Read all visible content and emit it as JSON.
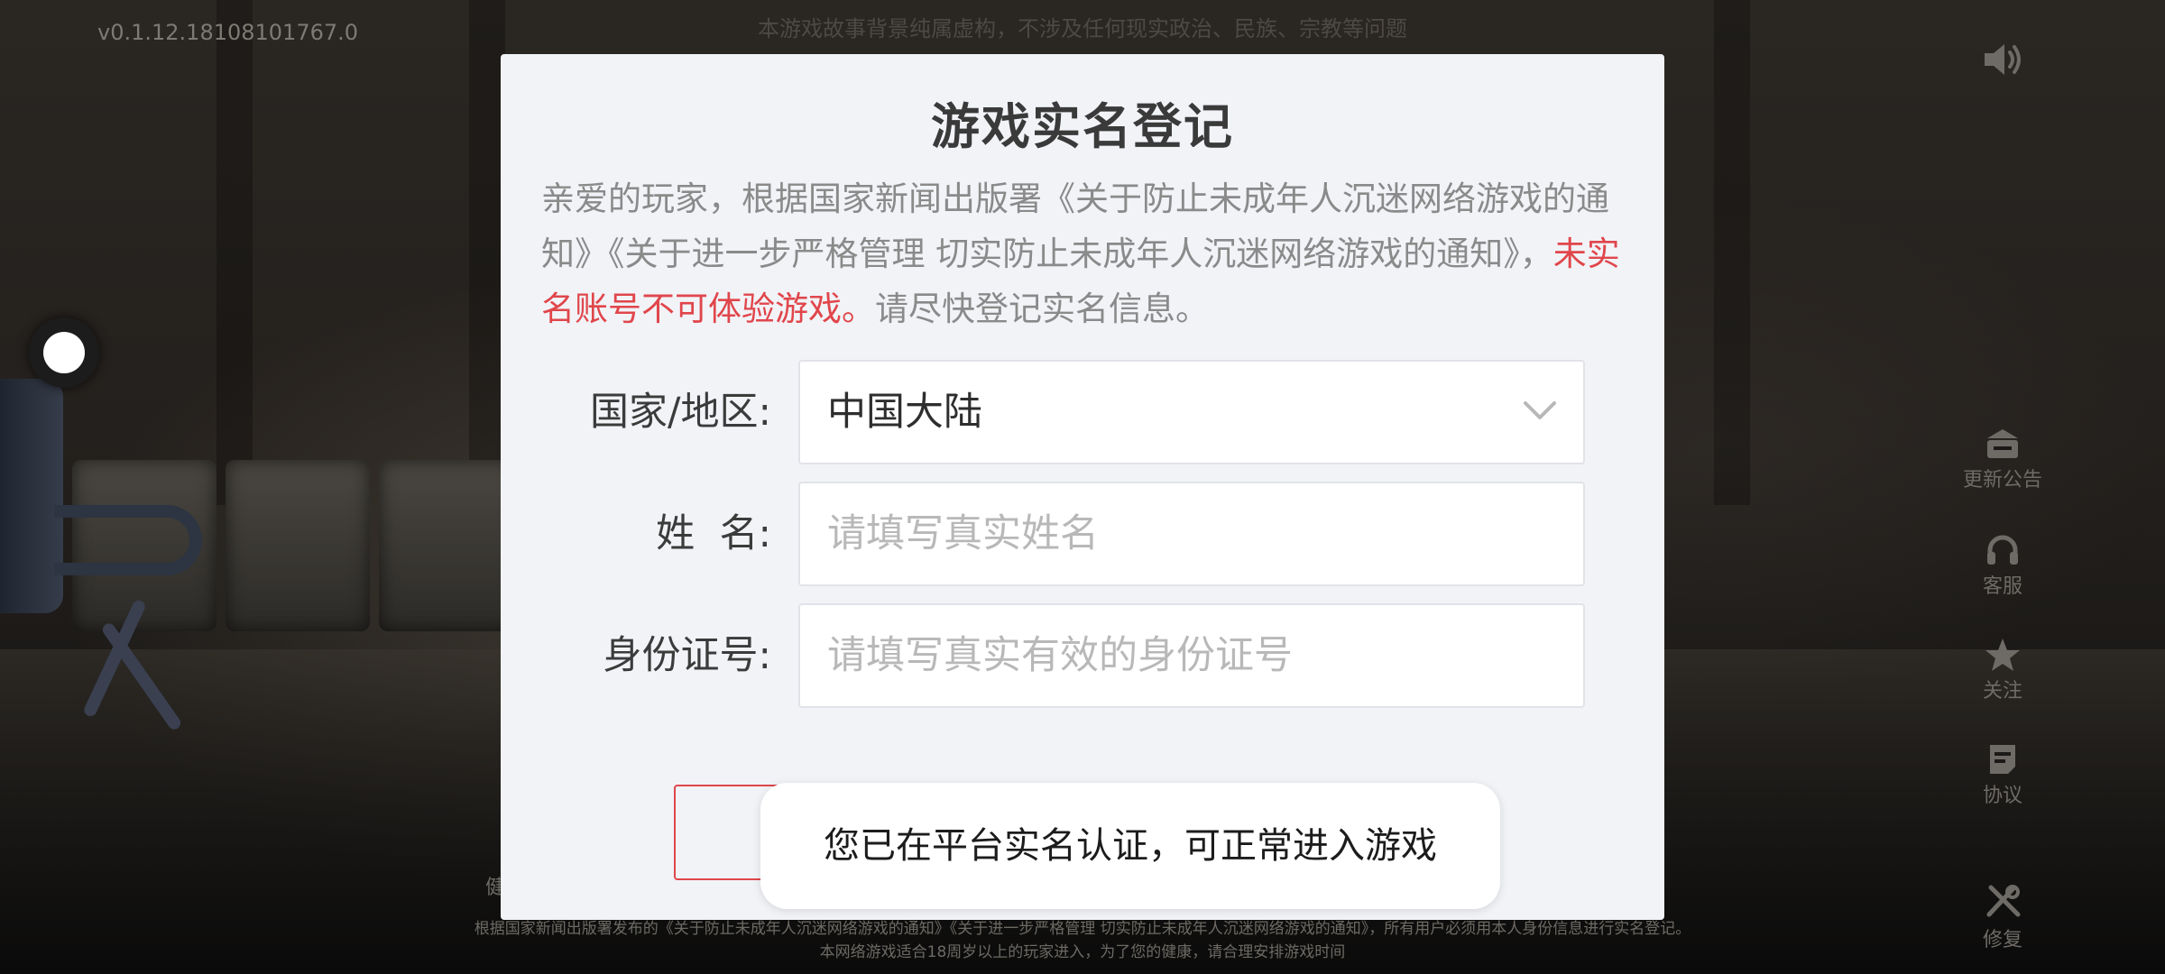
{
  "header": {
    "version": "v0.1.12.18108101767.0",
    "disclaimer": "本游戏故事背景纯属虚构，不涉及任何现实政治、民族、宗教等问题"
  },
  "side_menu": {
    "items": [
      {
        "icon": "announcement-icon",
        "label": "更新公告"
      },
      {
        "icon": "headset-icon",
        "label": "客服"
      },
      {
        "icon": "star-icon",
        "label": "关注"
      },
      {
        "icon": "document-icon",
        "label": "协议"
      },
      {
        "icon": "repair-icon",
        "label": "修复"
      }
    ],
    "sound_icon": "speaker-icon"
  },
  "dialog": {
    "title": "游戏实名登记",
    "notice_normal_1": "亲爱的玩家，根据国家新闻出版署《关于防止未成年人沉迷网络游戏的通知》《关于进一步严格管理 切实防止未成年人沉迷网络游戏的通知》，",
    "notice_warning": "未实名账号不可体验游戏。",
    "notice_normal_2": "请尽快登记实名信息。",
    "country_label": "国家/地区:",
    "country_value": "中国大陆",
    "name_label": "姓  名:",
    "name_placeholder": "请填写真实姓名",
    "id_label": "身份证号:",
    "id_placeholder": "请填写真实有效的身份证号"
  },
  "toast": {
    "message": "您已在平台实名认证，可正常进入游戏"
  },
  "footer": {
    "health_fragment": "健",
    "line1": "根据国家新闻出版署发布的《关于防止未成年人沉迷网络游戏的通知》《关于进一步严格管理 切实防止未成年人沉迷网络游戏的通知》，所有用户必须用本人身份信息进行实名登记。",
    "line2": "本网络游戏适合18周岁以上的玩家进入，为了您的健康，请合理安排游戏时间"
  },
  "colors": {
    "warning": "#e0464b",
    "dialog_bg": "#f1f3f7"
  }
}
